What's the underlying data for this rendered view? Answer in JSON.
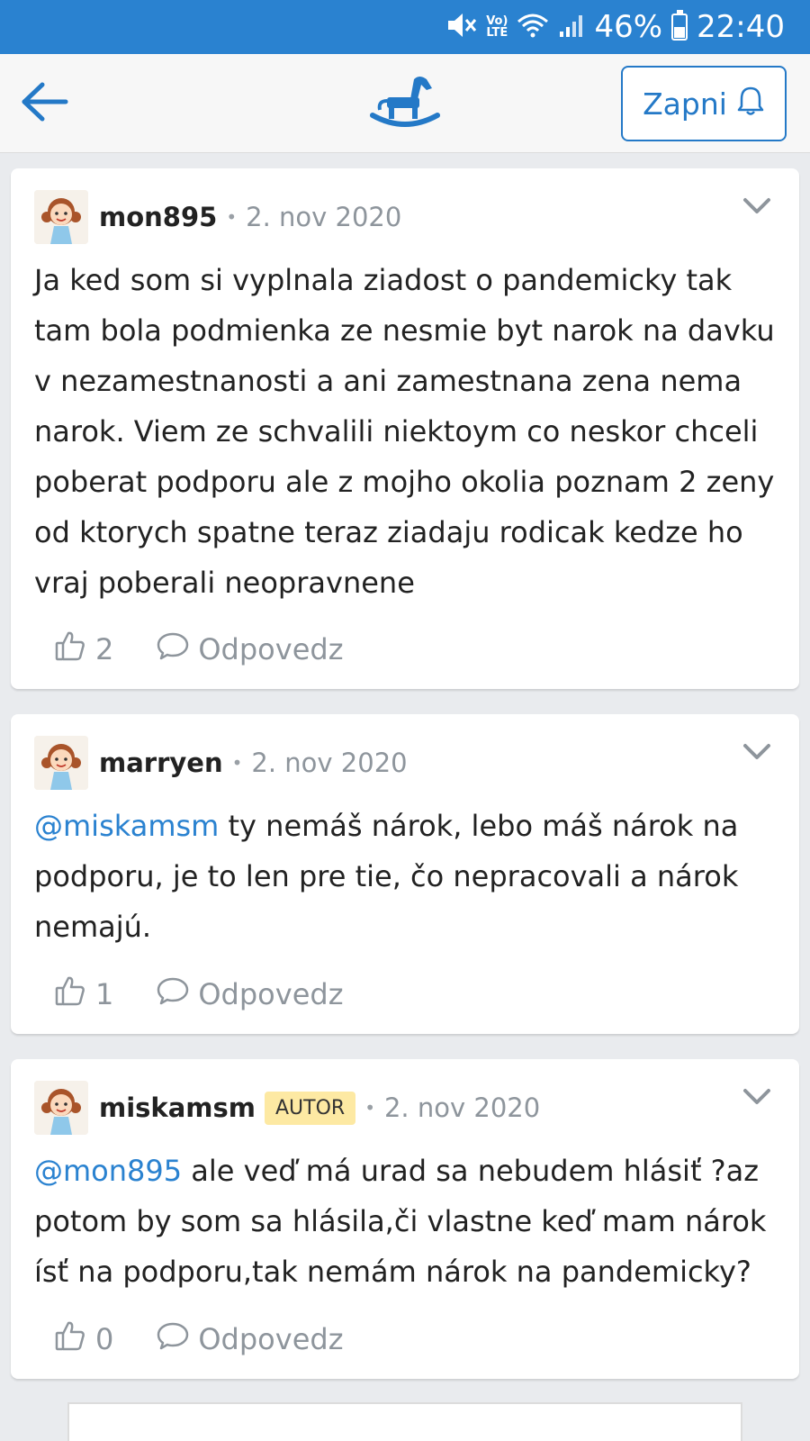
{
  "status_bar": {
    "battery": "46%",
    "time": "22:40",
    "network": "Vo) LTE",
    "icons": [
      "mute-icon",
      "wifi-icon",
      "signal-icon",
      "battery-icon"
    ]
  },
  "header": {
    "back_icon": "back-arrow-icon",
    "logo_icon": "rocking-horse-icon",
    "notify_label": "Zapni",
    "notify_icon": "bell-icon",
    "accent": "#2a82d0"
  },
  "comments": [
    {
      "author": "mon895",
      "badge": "",
      "date": "2. nov 2020",
      "mention": "",
      "text": "Ja ked som si vyplnala ziadost o pandemicky tak tam bola podmienka ze nesmie byt narok na davku v nezamestnanosti a ani zamestnana zena nema narok. Viem ze schvalili niektoym co neskor chceli poberat podporu ale z mojho okolia poznam 2 zeny od ktorych spatne teraz ziadaju rodicak kedze ho vraj poberali neopravnene",
      "likes": "2",
      "reply_label": "Odpovedz"
    },
    {
      "author": "marryen",
      "badge": "",
      "date": "2. nov 2020",
      "mention": "@miskamsm",
      "text": " ty nemáš nárok, lebo máš nárok na podporu, je to len pre tie, čo nepracovali a nárok nemajú.",
      "likes": "1",
      "reply_label": "Odpovedz"
    },
    {
      "author": "miskamsm",
      "badge": "AUTOR",
      "date": "2. nov 2020",
      "mention": "@mon895",
      "text": " ale veď má urad sa nebudem hlásiť ?az potom by som sa hlásila,či vlastne keď mam nárok ísť na podporu,tak nemám nárok na pandemicky?",
      "likes": "0",
      "reply_label": "Odpovedz"
    }
  ]
}
